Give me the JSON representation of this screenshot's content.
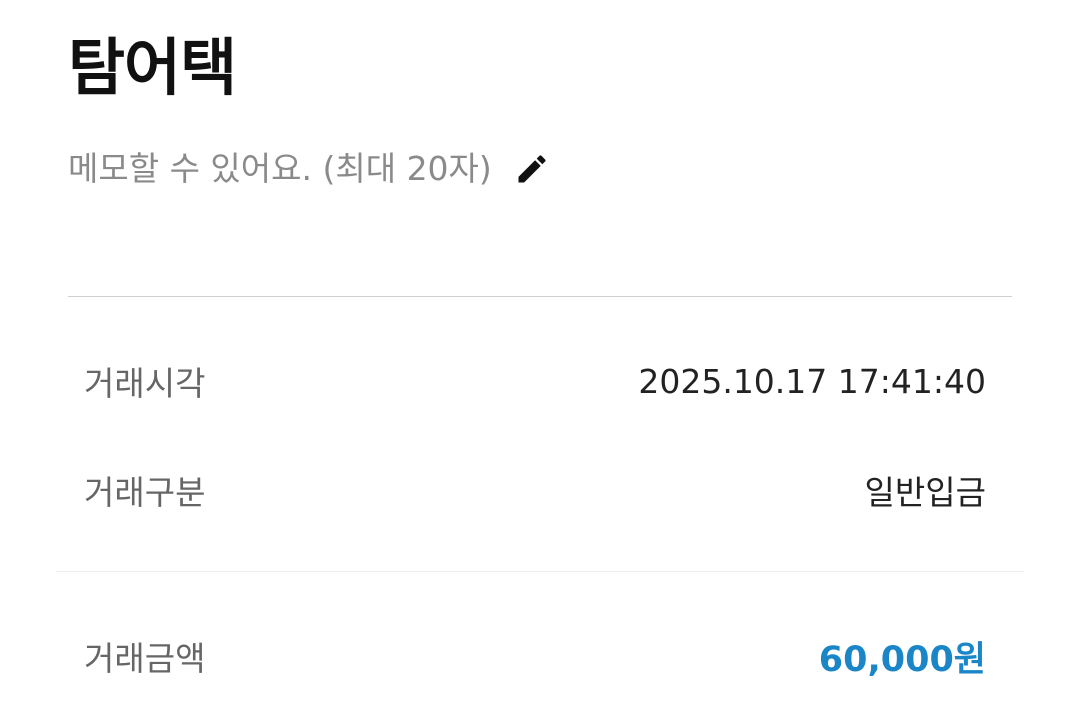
{
  "header": {
    "title": "탐어택"
  },
  "memo": {
    "placeholder": "메모할 수 있어요. (최대 20자)",
    "edit_icon": "pencil-icon"
  },
  "details": {
    "time": {
      "label": "거래시각",
      "value": "2025.10.17 17:41:40"
    },
    "type": {
      "label": "거래구분",
      "value": "일반입금"
    },
    "amount": {
      "label": "거래금액",
      "value": "60,000원"
    }
  },
  "colors": {
    "amount": "#1a86c8",
    "label": "#666666",
    "placeholder": "#8a8a8a"
  }
}
